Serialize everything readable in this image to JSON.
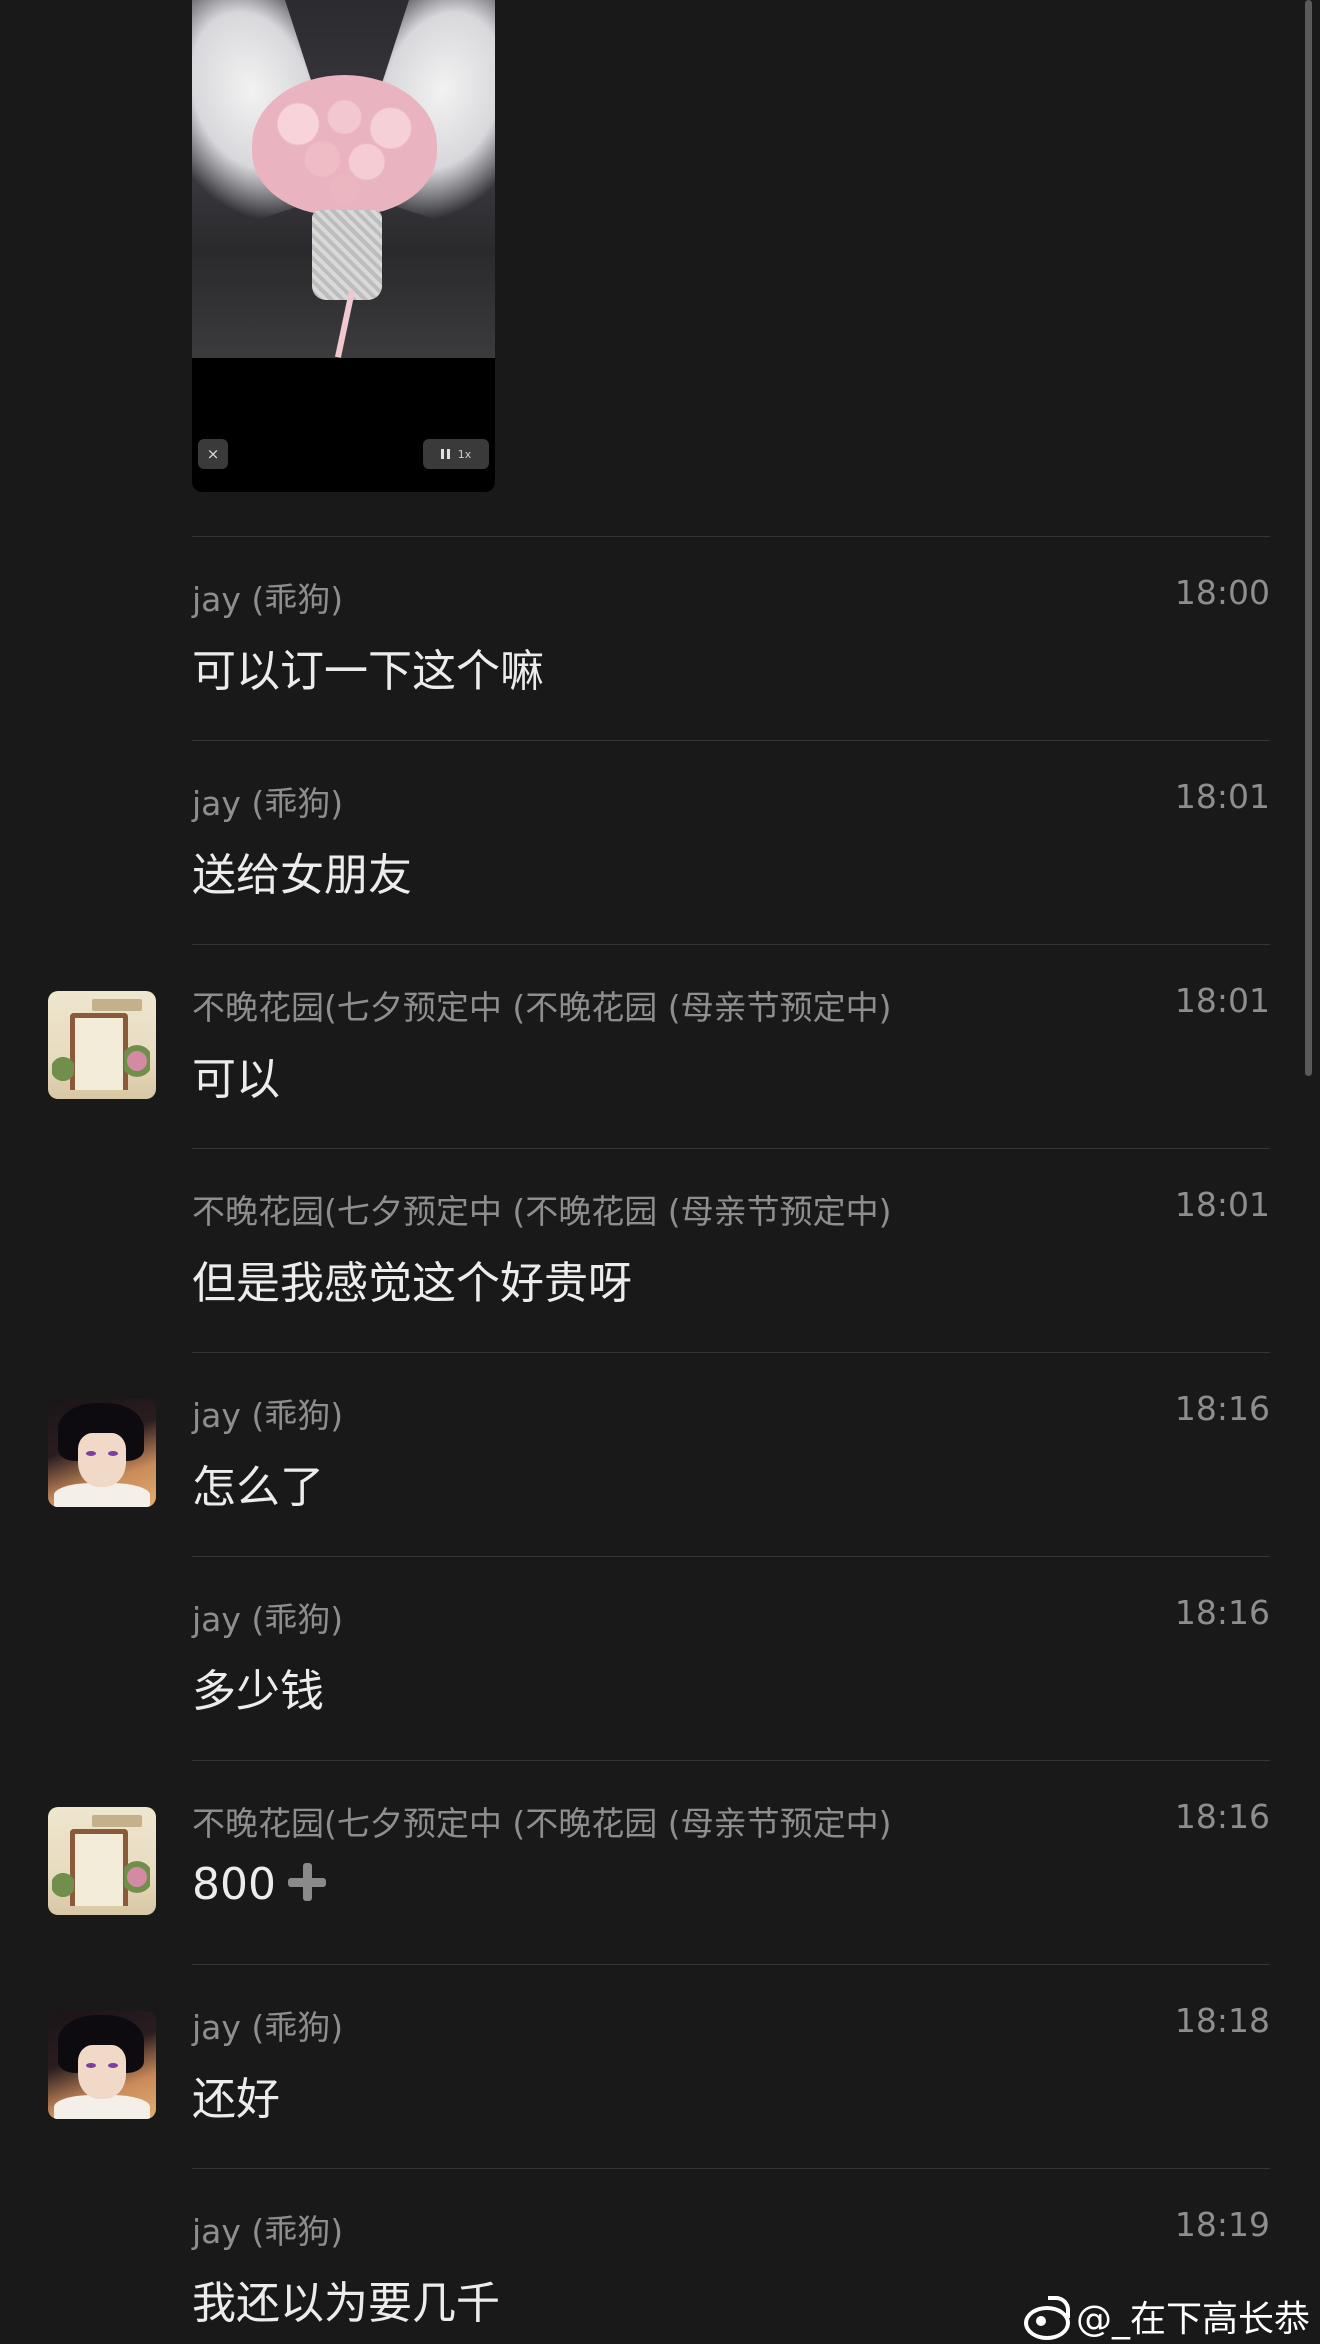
{
  "video": {
    "close_icon": "×",
    "speed_label": "1x"
  },
  "messages": [
    {
      "sender": "jay (乖狗)",
      "time": "18:00",
      "text": "可以订一下这个嘛",
      "avatar": null
    },
    {
      "sender": "jay (乖狗)",
      "time": "18:01",
      "text": "送给女朋友",
      "avatar": null
    },
    {
      "sender": "不晚花园(七夕预定中 (不晚花园 (母亲节预定中)",
      "time": "18:01",
      "text": "可以",
      "avatar": "shop"
    },
    {
      "sender": "不晚花园(七夕预定中 (不晚花园 (母亲节预定中)",
      "time": "18:01",
      "text": "但是我感觉这个好贵呀",
      "avatar": null
    },
    {
      "sender": "jay (乖狗)",
      "time": "18:16",
      "text": "怎么了",
      "avatar": "anime"
    },
    {
      "sender": "jay (乖狗)",
      "time": "18:16",
      "text": "多少钱",
      "avatar": null
    },
    {
      "sender": "不晚花园(七夕预定中 (不晚花园 (母亲节预定中)",
      "time": "18:16",
      "text": "800",
      "avatar": "shop",
      "emoji": "plus-icon"
    },
    {
      "sender": "jay (乖狗)",
      "time": "18:18",
      "text": "还好",
      "avatar": "anime"
    },
    {
      "sender": "jay (乖狗)",
      "time": "18:19",
      "text": "我还以为要几千",
      "avatar": null
    }
  ],
  "watermark": {
    "text": "@_在下高长恭",
    "icon": "weibo-icon"
  },
  "colors": {
    "background": "#191919",
    "divider": "#353535",
    "secondary_text": "#8e8e8e",
    "primary_text": "#ececec"
  }
}
